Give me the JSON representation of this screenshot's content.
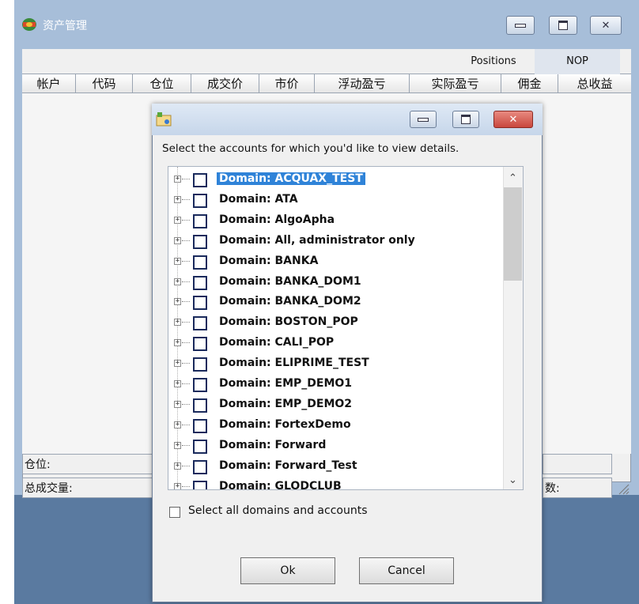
{
  "outer_window": {
    "title": "资产管理",
    "tabs": {
      "positions": "Positions",
      "nop": "NOP"
    },
    "columns": [
      "帐户",
      "代码",
      "仓位",
      "成交价",
      "市价",
      "浮动盈亏",
      "实际盈亏",
      "佣金",
      "总收益"
    ],
    "status_left": [
      "仓位:",
      "总成交量:"
    ],
    "status_right_fragment": "数:"
  },
  "dialog": {
    "instruction": "Select the accounts for which you'd like to view details.",
    "domains": [
      "Domain: ACQUAX_TEST",
      "Domain: ATA",
      "Domain: AlgoApha",
      "Domain: All, administrator only",
      "Domain: BANKA",
      "Domain: BANKA_DOM1",
      "Domain: BANKA_DOM2",
      "Domain: BOSTON_POP",
      "Domain: CALI_POP",
      "Domain: ELIPRIME_TEST",
      "Domain: EMP_DEMO1",
      "Domain: EMP_DEMO2",
      "Domain: FortexDemo",
      "Domain: Forward",
      "Domain: Forward_Test",
      "Domain: GLODCLUB"
    ],
    "selected_index": 0,
    "select_all_label": "Select all domains and accounts",
    "ok_label": "Ok",
    "cancel_label": "Cancel"
  },
  "colors": {
    "selection": "#2f83d8",
    "close_button": "#c9473d",
    "window_frame": "#a7bed9"
  }
}
